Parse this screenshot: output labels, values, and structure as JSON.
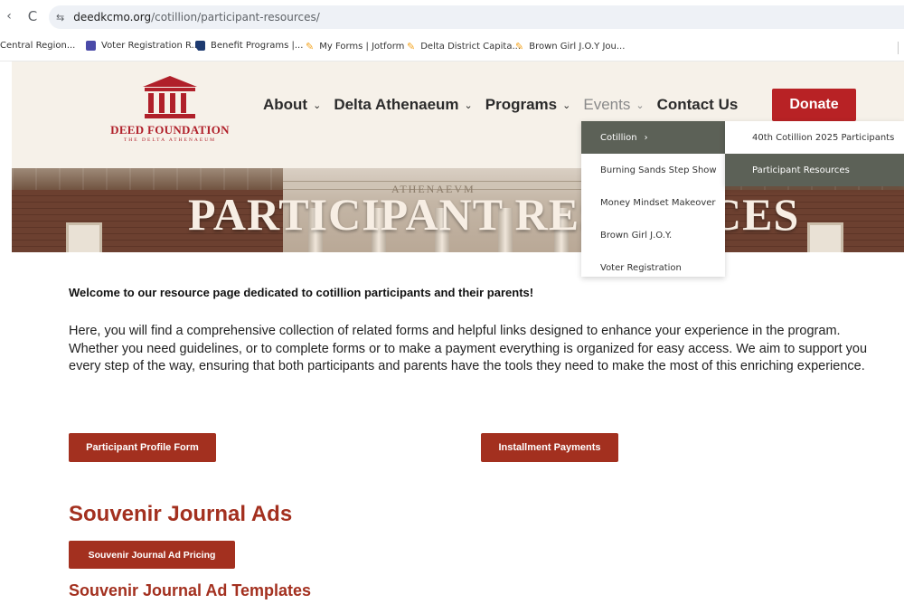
{
  "browser": {
    "back_glyph": "‹",
    "reload_glyph": "C",
    "site_info_glyph": "⇆",
    "url_domain": "deedkcmo.org",
    "url_path": "/cotillion/participant-resources/",
    "bookmarks": [
      {
        "label": "Central Region...",
        "icon": "folder-icon"
      },
      {
        "label": "Voter Registration R...",
        "icon": "form-icon"
      },
      {
        "label": "Benefit Programs |...",
        "icon": "missouri-icon"
      },
      {
        "label": "My Forms | Jotform",
        "icon": "jotform-icon"
      },
      {
        "label": "Delta District Capita...",
        "icon": "jotform-icon"
      },
      {
        "label": "Brown Girl J.O.Y Jou...",
        "icon": "jotform-icon"
      }
    ]
  },
  "header": {
    "logo_name": "DEED FOUNDATION",
    "logo_sub": "THE DELTA ATHENAEUM",
    "nav": [
      {
        "label": "About",
        "chevron": "⌄"
      },
      {
        "label": "Delta Athenaeum",
        "chevron": "⌄"
      },
      {
        "label": "Programs",
        "chevron": "⌄"
      },
      {
        "label": "Events",
        "chevron": "⌄"
      },
      {
        "label": "Contact Us"
      }
    ],
    "donate_label": "Donate",
    "accent_color": "#b82225"
  },
  "hero": {
    "title": "PARTICIPANT RESOURCES",
    "inscription": "ATHENAEVM"
  },
  "events_menu": {
    "items": [
      {
        "label": "Cotillion",
        "arrow": "›"
      },
      {
        "label": "Burning Sands Step Show"
      },
      {
        "label": "Money Mindset Makeover"
      },
      {
        "label": "Brown Girl J.O.Y."
      },
      {
        "label": "Voter Registration"
      }
    ],
    "cotillion_submenu": [
      {
        "label": "40th Cotillion 2025 Participants"
      },
      {
        "label": "Participant Resources"
      }
    ]
  },
  "content": {
    "welcome": "Welcome to our resource page dedicated to cotillion participants and their parents!",
    "intro": "Here, you will find a comprehensive collection of related forms and helpful links designed to enhance your experience in the program. Whether you need guidelines, or to complete forms or to make a payment everything is organized for easy access. We aim to support you every step of the way, ensuring that both participants and parents have the tools they need to make the most of this enriching experience.",
    "profile_button": "Participant Profile Form",
    "installment_button": "Installment Payments",
    "journal_heading": "Souvenir Journal Ads",
    "pricing_button": "Souvenir Journal Ad Pricing",
    "templates_heading": "Souvenir Journal Ad Templates",
    "button_color": "#a3301f"
  }
}
